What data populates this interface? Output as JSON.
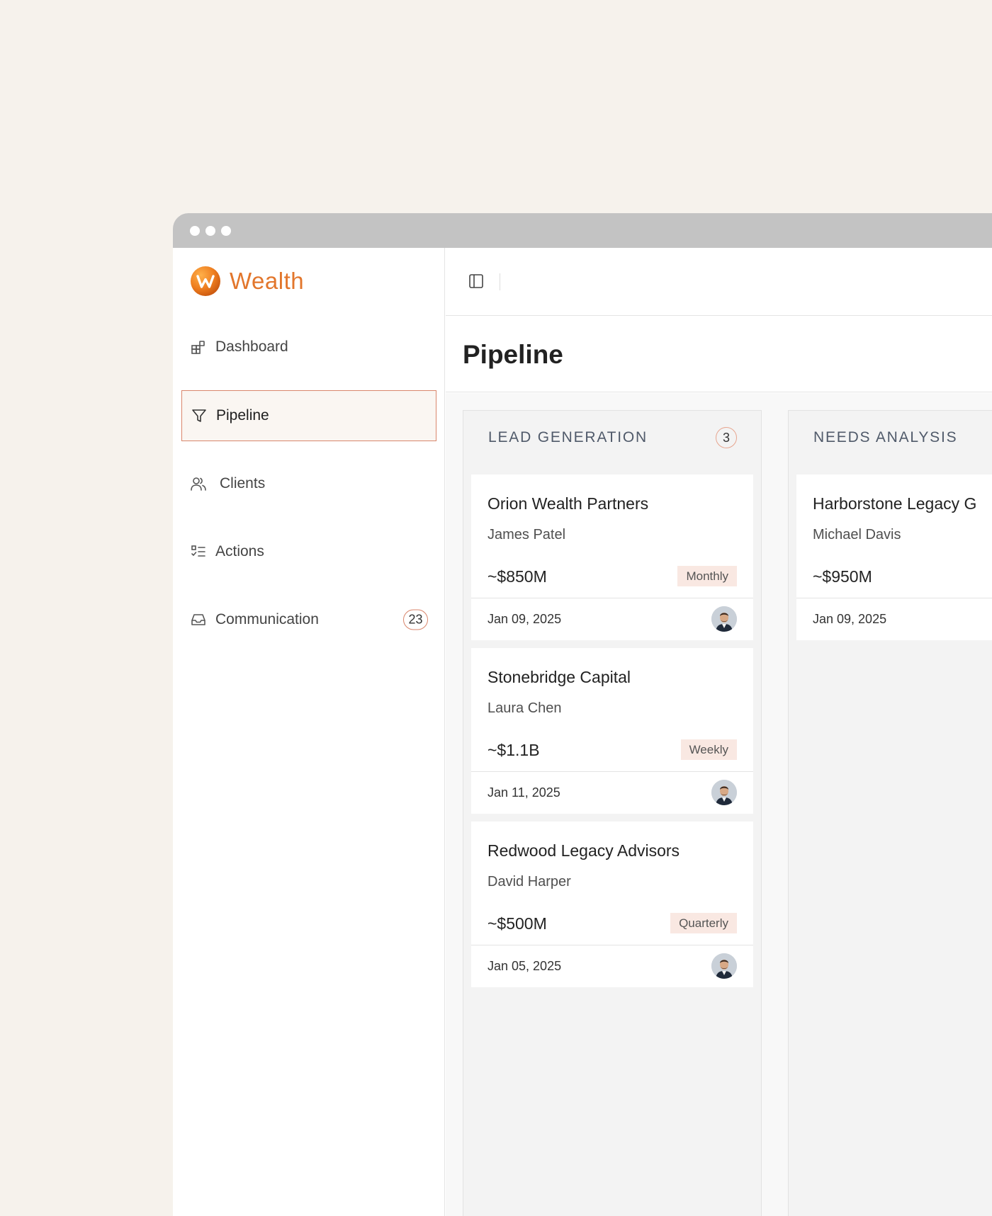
{
  "app": {
    "name": "Wealth",
    "accent_color": "#e2762c"
  },
  "nav": {
    "items": [
      {
        "label": "Dashboard",
        "icon": "dashboard-icon"
      },
      {
        "label": "Pipeline",
        "icon": "funnel-icon",
        "active": true
      },
      {
        "label": "Clients",
        "icon": "users-icon"
      },
      {
        "label": "Actions",
        "icon": "checklist-icon"
      },
      {
        "label": "Communication",
        "icon": "inbox-icon",
        "badge": "23"
      }
    ]
  },
  "page": {
    "title": "Pipeline"
  },
  "columns": [
    {
      "title": "LEAD GENERATION",
      "count": "3",
      "cards": [
        {
          "company": "Orion Wealth Partners",
          "contact": "James Patel",
          "value": "~$850M",
          "frequency": "Monthly",
          "date": "Jan 09, 2025"
        },
        {
          "company": "Stonebridge Capital",
          "contact": "Laura Chen",
          "value": "~$1.1B",
          "frequency": "Weekly",
          "date": "Jan 11, 2025"
        },
        {
          "company": "Redwood Legacy Advisors",
          "contact": "David Harper",
          "value": "~$500M",
          "frequency": "Quarterly",
          "date": "Jan 05, 2025"
        }
      ]
    },
    {
      "title": "NEEDS ANALYSIS",
      "cards": [
        {
          "company": "Harborstone Legacy G",
          "contact": "Michael Davis",
          "value": "~$950M",
          "date": "Jan 09, 2025"
        }
      ]
    }
  ]
}
